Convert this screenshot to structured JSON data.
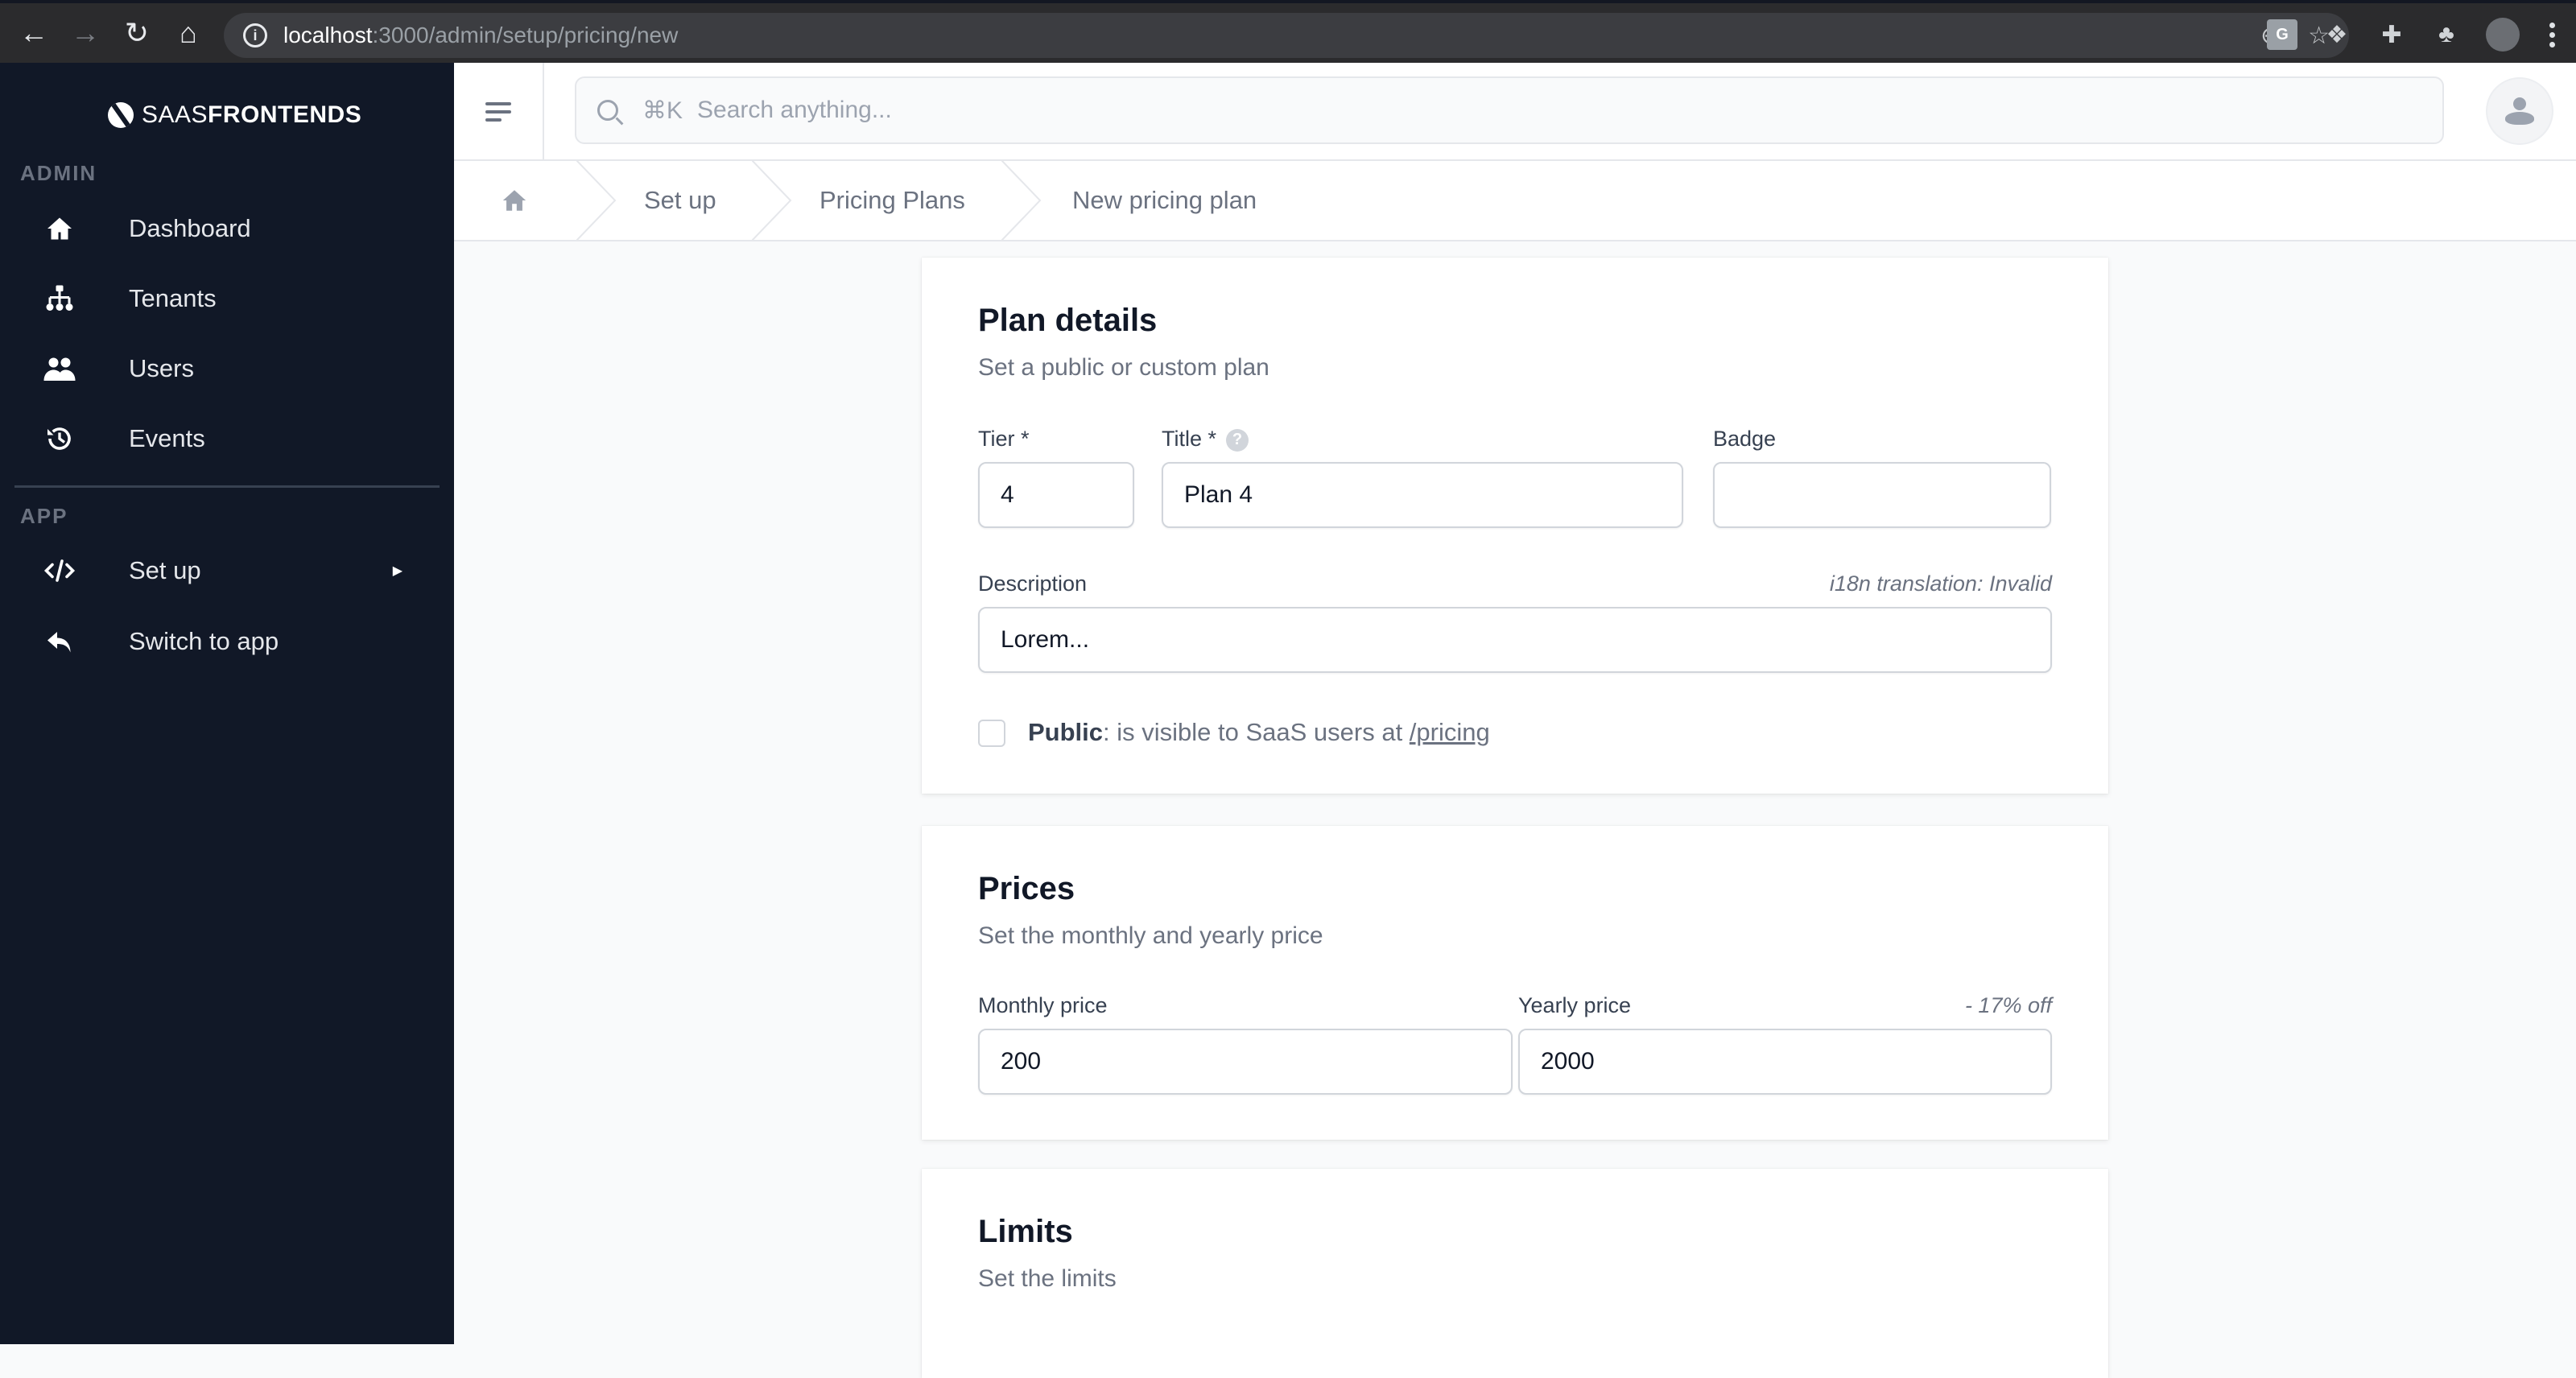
{
  "browser": {
    "url_host": "localhost",
    "url_path": ":3000/admin/setup/pricing/new",
    "icons": [
      "back-icon",
      "forward-icon",
      "reload-icon",
      "home-icon",
      "site-info-icon",
      "zoom-icon",
      "bookmark-star-icon",
      "google-translate-icon",
      "dropbox-icon",
      "clock-extension-icon",
      "extensions-puzzle-icon",
      "profile-avatar-icon",
      "kebab-menu-icon"
    ]
  },
  "sidebar": {
    "brand_thin": "SAAS",
    "brand_bold": "FRONTENDS",
    "sections": [
      {
        "label": "ADMIN",
        "items": [
          {
            "label": "Dashboard",
            "icon": "home-icon"
          },
          {
            "label": "Tenants",
            "icon": "sitemap-icon"
          },
          {
            "label": "Users",
            "icon": "users-icon"
          },
          {
            "label": "Events",
            "icon": "history-icon"
          }
        ]
      },
      {
        "label": "APP",
        "items": [
          {
            "label": "Set up",
            "icon": "code-icon",
            "has_submenu": true
          },
          {
            "label": "Switch to app",
            "icon": "reply-arrow-icon"
          }
        ]
      }
    ]
  },
  "topbar": {
    "search_shortcut": "⌘K",
    "search_placeholder": "Search anything..."
  },
  "breadcrumb": {
    "items": [
      "Set up",
      "Pricing Plans",
      "New pricing plan"
    ]
  },
  "plan_details": {
    "title": "Plan details",
    "subtitle": "Set a public or custom plan",
    "tier_label": "Tier *",
    "tier_value": "4",
    "title_label": "Title *",
    "title_help": "?",
    "title_value": "Plan 4",
    "badge_label": "Badge",
    "badge_value": "",
    "description_label": "Description",
    "description_hint": "i18n translation: Invalid",
    "description_value": "Lorem...",
    "public_checked": false,
    "public_bold": "Public",
    "public_text": ": is visible to SaaS users at ",
    "public_link": "/pricing"
  },
  "prices": {
    "title": "Prices",
    "subtitle": "Set the monthly and yearly price",
    "monthly_label": "Monthly price",
    "monthly_value": "200",
    "yearly_label": "Yearly price",
    "yearly_discount": "- 17% off",
    "yearly_value": "2000"
  },
  "limits": {
    "title": "Limits",
    "subtitle": "Set the limits"
  }
}
